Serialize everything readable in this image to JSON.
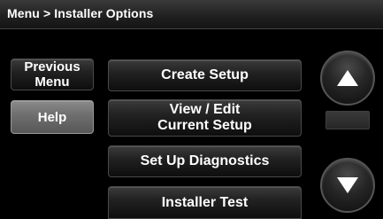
{
  "breadcrumb": {
    "text": "Menu > Installer Options"
  },
  "left_buttons": {
    "previous_menu": [
      "Previous",
      "Menu"
    ],
    "help": "Help"
  },
  "options": [
    [
      "Create Setup"
    ],
    [
      "View / Edit",
      "Current Setup"
    ],
    [
      "Set Up Diagnostics"
    ],
    [
      "Installer Test"
    ]
  ],
  "scroll": {
    "up_icon": "arrow-up-icon",
    "down_icon": "arrow-down-icon"
  },
  "colors": {
    "background": "#000000",
    "help_button": "#6e6e6e"
  }
}
